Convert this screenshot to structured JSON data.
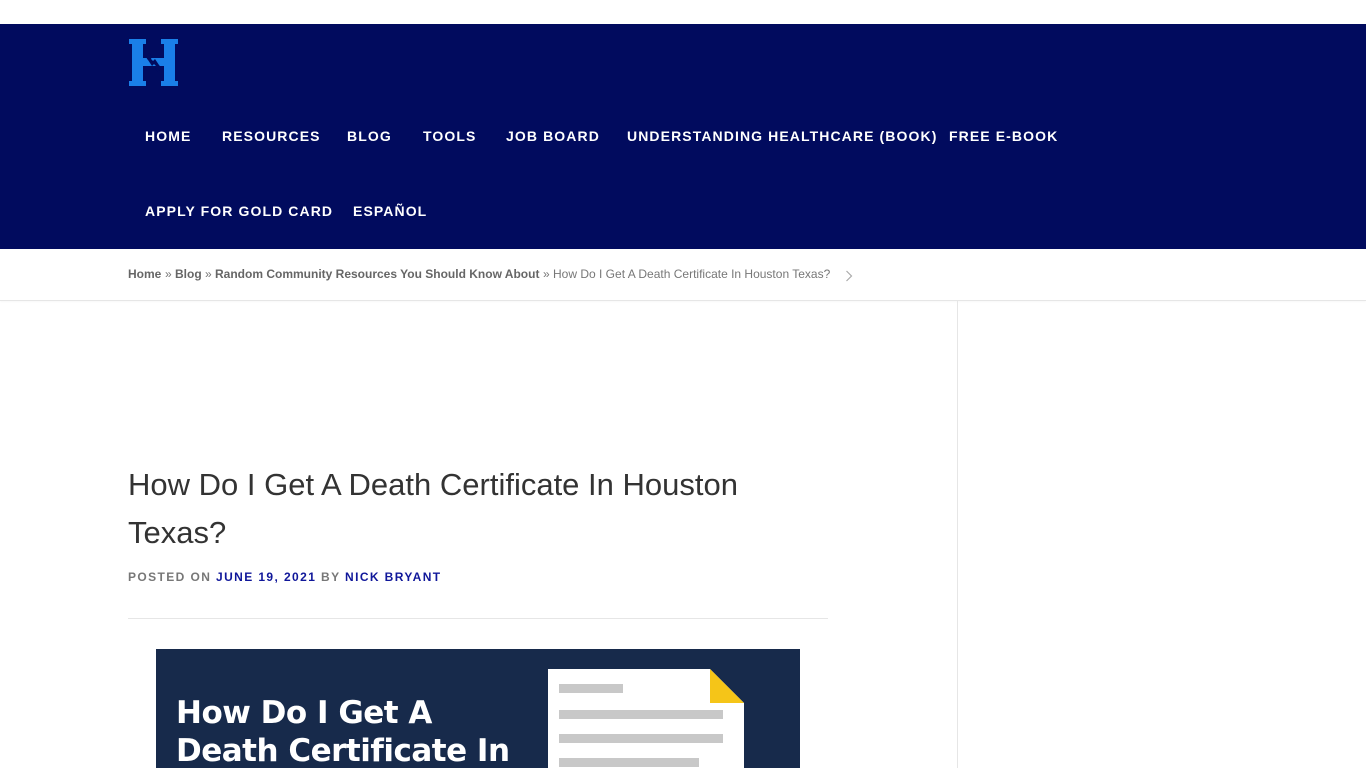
{
  "brand": {
    "logo_icon": "h-hands-logo-icon",
    "color": "#1a7fe8"
  },
  "colors": {
    "header_bg": "#010b5e",
    "link_blue": "#10179a",
    "feature_bg": "#172a4b",
    "doc_corner": "#f5c518"
  },
  "nav": {
    "items": [
      {
        "label": "HOME"
      },
      {
        "label": "RESOURCES"
      },
      {
        "label": "BLOG"
      },
      {
        "label": "TOOLS"
      },
      {
        "label": "JOB BOARD"
      },
      {
        "label": "UNDERSTANDING HEALTHCARE (BOOK)"
      },
      {
        "label": "FREE E-BOOK"
      },
      {
        "label": "APPLY FOR GOLD CARD"
      },
      {
        "label": "ESPAÑOL"
      }
    ]
  },
  "breadcrumb": {
    "items": [
      {
        "label": "Home"
      },
      {
        "label": "Blog"
      },
      {
        "label": "Random Community Resources You Should Know About"
      }
    ],
    "separator": "»",
    "current": "How Do I Get A Death Certificate In Houston Texas?",
    "chevron_icon": "chevron-right-icon"
  },
  "post": {
    "title": "How Do I Get A Death Certificate In Houston Texas?",
    "meta": {
      "posted_on_label": "POSTED ON",
      "date": "JUNE 19, 2021",
      "by_label": "BY",
      "author": "NICK BRYANT"
    },
    "featured_image": {
      "title": "How Do I Get A Death Certificate In",
      "icon": "document-icon"
    }
  }
}
